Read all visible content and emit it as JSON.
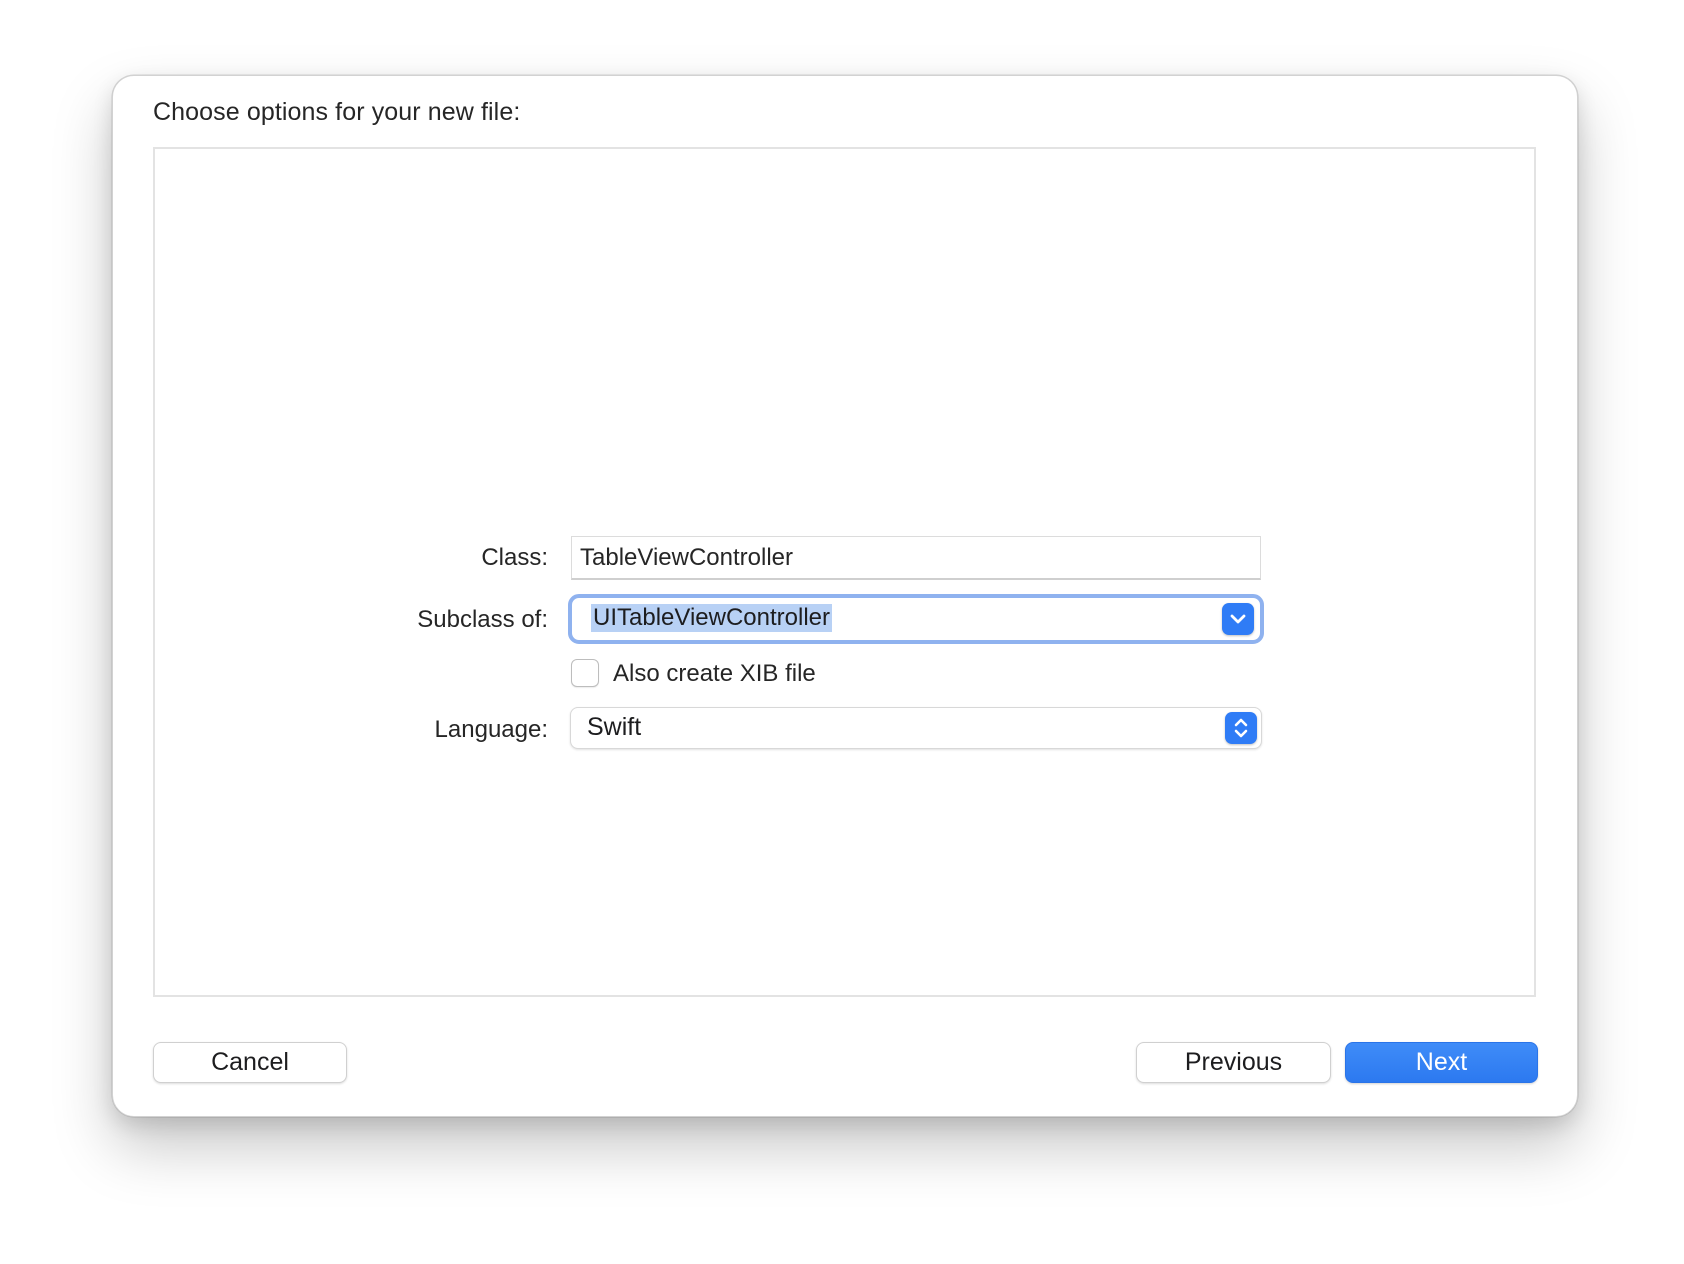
{
  "dialog": {
    "title": "Choose options for your new file:"
  },
  "form": {
    "class": {
      "label": "Class:",
      "value": "TableViewController"
    },
    "subclass": {
      "label": "Subclass of:",
      "value": "UITableViewController",
      "icon": "chevron-down-icon"
    },
    "xib": {
      "label": "Also create XIB file",
      "checked": false
    },
    "language": {
      "label": "Language:",
      "value": "Swift",
      "icon": "up-down-chevron-icon"
    }
  },
  "buttons": {
    "cancel": "Cancel",
    "previous": "Previous",
    "next": "Next"
  },
  "colors": {
    "accent": "#2f7cf6",
    "focus_ring": "#8fb2ef",
    "selection": "#b8d1f5"
  }
}
